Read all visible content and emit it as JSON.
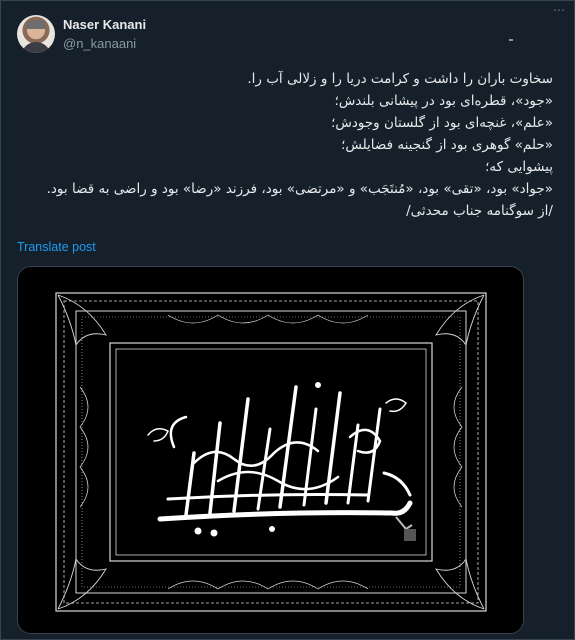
{
  "author": {
    "display_name": "Naser Kanani",
    "handle": "@n_kanaani"
  },
  "tweet": {
    "lines": [
      "سخاوت باران را داشت و کرامت دریا را و زلالی آب را.",
      "«جود»، قطره‌ای بود در پیشانی بلندش؛",
      "«علم»، غنچه‌ای بود از گلستان وجودش؛",
      "«حلم» گوهری بود از گنجینه فضایلش؛",
      "پیشوایی که؛",
      "«جواد» بود، «تقی» بود، «مُنتَجَب» و «مرتضی» بود، فرزند «رضا» بود و راضی به قضا بود.",
      "/از سوگنامه جناب محدثی/"
    ],
    "translate_label": "Translate post"
  },
  "media": {
    "type": "calligraphy artwork",
    "icon": "calligraphy-image",
    "background_color": "#000000",
    "ink_color": "#ffffff"
  }
}
